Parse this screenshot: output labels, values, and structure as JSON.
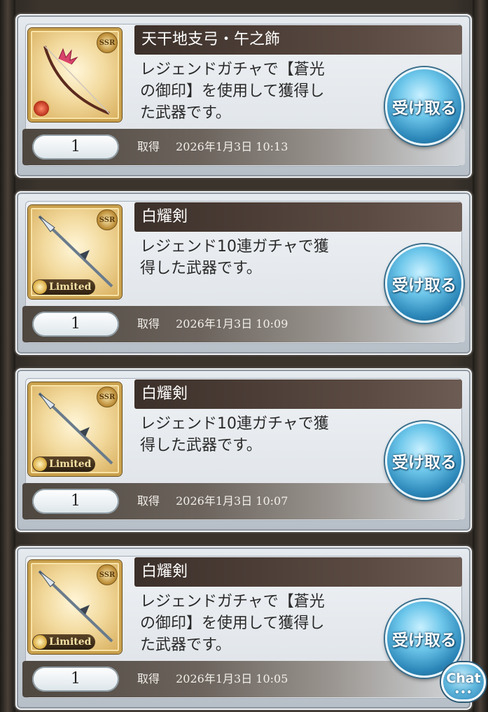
{
  "items": [
    {
      "name": "天干地支弓・午之飾",
      "description_lines": [
        "レジェンドガチャで【蒼光",
        "の御印】を使用して獲得し",
        "た武器です。"
      ],
      "rarity": "SSR",
      "badge": "",
      "quantity": "1",
      "acquired_label": "取得",
      "acquired_time": "2026年1月3日 10:13",
      "button_label": "受け取る",
      "icon": "bow-icon"
    },
    {
      "name": "白耀剣",
      "description_lines": [
        "レジェンド10連ガチャで獲",
        "得した武器です。"
      ],
      "rarity": "SSR",
      "badge": "Limited",
      "quantity": "1",
      "acquired_label": "取得",
      "acquired_time": "2026年1月3日 10:09",
      "button_label": "受け取る",
      "icon": "spear-icon"
    },
    {
      "name": "白耀剣",
      "description_lines": [
        "レジェンド10連ガチャで獲",
        "得した武器です。"
      ],
      "rarity": "SSR",
      "badge": "Limited",
      "quantity": "1",
      "acquired_label": "取得",
      "acquired_time": "2026年1月3日 10:07",
      "button_label": "受け取る",
      "icon": "spear-icon"
    },
    {
      "name": "白耀剣",
      "description_lines": [
        "レジェンドガチャで【蒼光",
        "の御印】を使用して獲得し",
        "た武器です。"
      ],
      "rarity": "SSR",
      "badge": "Limited",
      "quantity": "1",
      "acquired_label": "取得",
      "acquired_time": "2026年1月3日 10:05",
      "button_label": "受け取る",
      "icon": "spear-icon"
    }
  ],
  "chat": {
    "label": "Chat",
    "dots": "•••"
  }
}
